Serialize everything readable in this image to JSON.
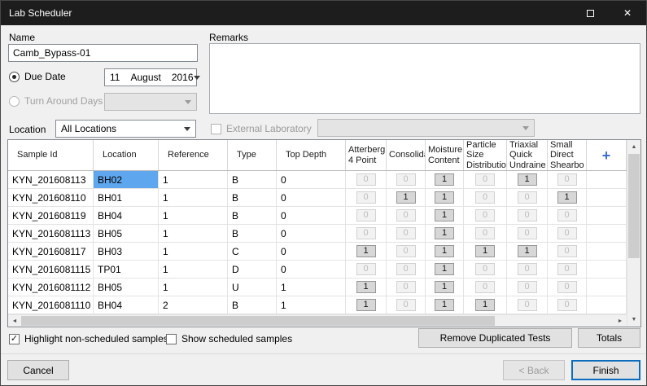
{
  "window": {
    "title": "Lab Scheduler"
  },
  "form": {
    "name_label": "Name",
    "name_value": "Camb_Bypass-01",
    "due_date_label": "Due Date",
    "due_date": {
      "day": "11",
      "month": "August",
      "year": "2016"
    },
    "turn_around_label": "Turn Around Days",
    "remarks_label": "Remarks",
    "remarks_value": "",
    "location_label": "Location",
    "location_value": "All Locations",
    "external_lab_label": "External Laboratory",
    "external_lab_value": ""
  },
  "table": {
    "columns": [
      "Sample Id",
      "Location",
      "Reference",
      "Type",
      "Top Depth",
      "Atterberg\n4 Point",
      "Consolida",
      "Moisture\nContent",
      "Particle\nSize\nDistributio",
      "Triaxial\nQuick\nUndraine",
      "Small\nDirect\nShearbo"
    ],
    "add_column_icon": "+",
    "rows": [
      {
        "sample_id": "KYN_201608113",
        "location": "BH02",
        "reference": "1",
        "type": "B",
        "top_depth": "0",
        "tests": [
          0,
          0,
          1,
          0,
          1,
          0
        ],
        "selected_cell": "location"
      },
      {
        "sample_id": "KYN_201608110",
        "location": "BH01",
        "reference": "1",
        "type": "B",
        "top_depth": "0",
        "tests": [
          0,
          1,
          1,
          0,
          0,
          1
        ]
      },
      {
        "sample_id": "KYN_201608119",
        "location": "BH04",
        "reference": "1",
        "type": "B",
        "top_depth": "0",
        "tests": [
          0,
          0,
          1,
          0,
          0,
          0
        ]
      },
      {
        "sample_id": "KYN_2016081113",
        "location": "BH05",
        "reference": "1",
        "type": "B",
        "top_depth": "0",
        "tests": [
          0,
          0,
          1,
          0,
          0,
          0
        ]
      },
      {
        "sample_id": "KYN_201608117",
        "location": "BH03",
        "reference": "1",
        "type": "C",
        "top_depth": "0",
        "tests": [
          1,
          0,
          1,
          1,
          1,
          0
        ]
      },
      {
        "sample_id": "KYN_2016081115",
        "location": "TP01",
        "reference": "1",
        "type": "D",
        "top_depth": "0",
        "tests": [
          0,
          0,
          1,
          0,
          0,
          0
        ]
      },
      {
        "sample_id": "KYN_2016081112",
        "location": "BH05",
        "reference": "1",
        "type": "U",
        "top_depth": "1",
        "tests": [
          1,
          0,
          1,
          0,
          0,
          0
        ]
      },
      {
        "sample_id": "KYN_2016081110",
        "location": "BH04",
        "reference": "2",
        "type": "B",
        "top_depth": "1",
        "tests": [
          1,
          0,
          1,
          1,
          0,
          0
        ]
      }
    ]
  },
  "footer": {
    "highlight_label": "Highlight non-scheduled samples",
    "show_label": "Show scheduled samples",
    "remove_duplicated_button": "Remove Duplicated Tests",
    "totals_button": "Totals",
    "cancel_button": "Cancel",
    "back_button": "< Back",
    "finish_button": "Finish"
  },
  "colors": {
    "selection_blue": "#5ea6ee",
    "accent_blue": "#0c6cbd",
    "add_icon_blue": "#3a6fd8",
    "titlebar": "#1d1d1d"
  }
}
